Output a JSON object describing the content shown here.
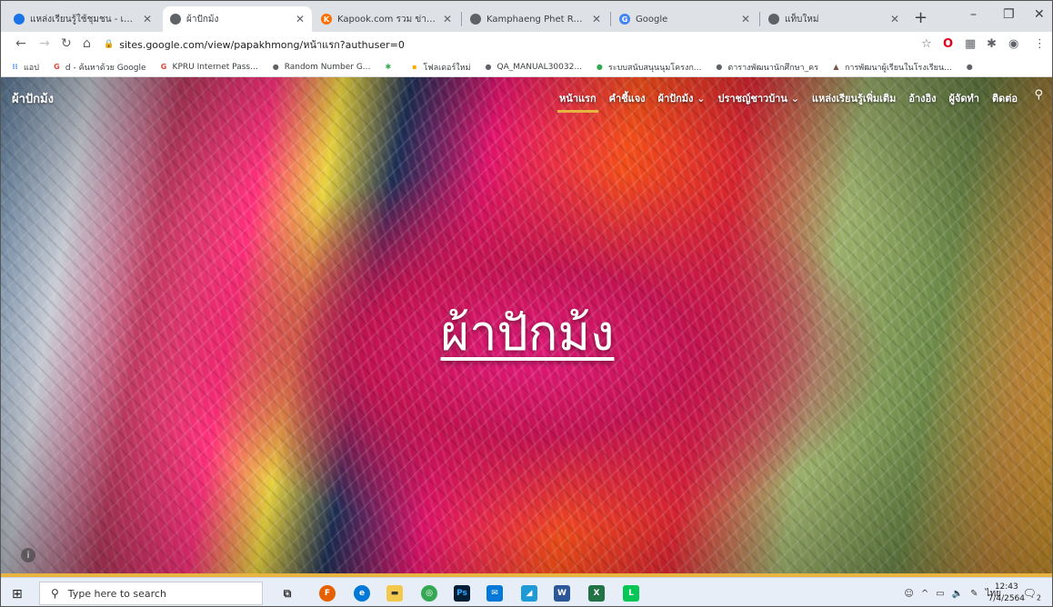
{
  "tabs": [
    {
      "title": "แหล่งเรียนรู้ใช้ชุมชน - เกี่ยวกับโครง",
      "fav_color": "#1a73e8",
      "fav_glyph": "●"
    },
    {
      "title": "ผ้าปักม้ง",
      "fav_color": "#5f6368",
      "fav_glyph": "●",
      "active": true
    },
    {
      "title": "Kapook.com รวม ข่าว ผลบอล ดู",
      "fav_color": "#ff6f00",
      "fav_glyph": "K"
    },
    {
      "title": "Kamphaeng Phet Rajabhat U",
      "fav_color": "#5f6368",
      "fav_glyph": "●"
    },
    {
      "title": "Google",
      "fav_color": "#4285f4",
      "fav_glyph": "G"
    },
    {
      "title": "แท็บใหม่",
      "fav_color": "#5f6368",
      "fav_glyph": "●"
    }
  ],
  "window": {
    "minimize": "–",
    "maximize": "❐",
    "close": "✕",
    "new_tab": "+"
  },
  "address_bar": {
    "url": "sites.google.com/view/papakhmong/หน้าแรก?authuser=0"
  },
  "bookmarks": [
    {
      "label": "แอป",
      "color": "#4285f4",
      "glyph": "⋮"
    },
    {
      "label": "d - ค้นหาด้วย Google",
      "color": "#ea4335",
      "glyph": "G"
    },
    {
      "label": "KPRU Internet Pass...",
      "color": "#ea4335",
      "glyph": "G"
    },
    {
      "label": "Random Number G...",
      "color": "#5f6368",
      "glyph": "●"
    },
    {
      "label": "",
      "color": "#34a853",
      "glyph": "✱"
    },
    {
      "label": "โฟลเดอร์ใหม่",
      "color": "#f9ab00",
      "glyph": "▪"
    },
    {
      "label": "QA_MANUAL30032...",
      "color": "#5f6368",
      "glyph": "●"
    },
    {
      "label": "ระบบสนับสนุนนุมโครงก...",
      "color": "#34a853",
      "glyph": "●"
    },
    {
      "label": "ตารางพัฒนานักศึกษา_คร",
      "color": "#5f6368",
      "glyph": "●"
    },
    {
      "label": "การพัฒนาผู้เรียนในโรงเรียน...",
      "color": "#795548",
      "glyph": "▲"
    },
    {
      "label": "",
      "color": "#5f6368",
      "glyph": "●"
    }
  ],
  "site": {
    "name": "ผ้าปักม้ง",
    "menu": [
      {
        "label": "หน้าแรก",
        "current": true
      },
      {
        "label": "คำชี้แจง"
      },
      {
        "label": "ผ้าปักม้ง ⌄"
      },
      {
        "label": "ปราชญ์ชาวบ้าน ⌄"
      },
      {
        "label": "แหล่งเรียนรู้เพิ่มเติม"
      },
      {
        "label": "อ้างอิง"
      },
      {
        "label": "ผู้จัดทำ"
      },
      {
        "label": "ติดต่อ"
      }
    ],
    "hero_title": "ผ้าปักม้ง"
  },
  "taskbar": {
    "search_placeholder": "Type here to search",
    "tray_lang": "ไทย",
    "time": "12:43",
    "date": "7/4/2564",
    "notifications": "2"
  }
}
